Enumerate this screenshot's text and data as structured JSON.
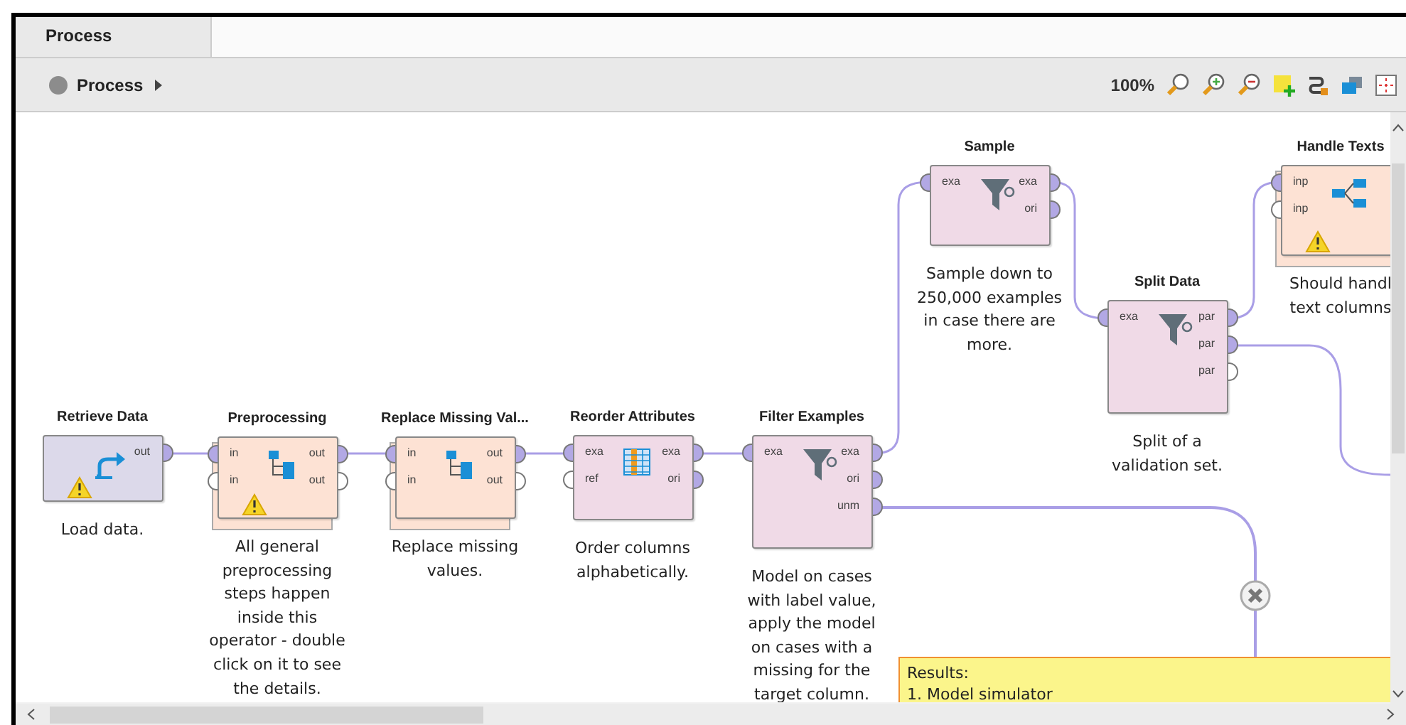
{
  "tab": {
    "label": "Process",
    "selected": true
  },
  "breadcrumb": {
    "label": "Process"
  },
  "zoom": "100%",
  "nodes": [
    {
      "title": "Retrieve Data",
      "kind": "retrieve",
      "warning": true,
      "out_ports": [
        {
          "label": "out",
          "connected": true
        }
      ],
      "description": "Load data."
    },
    {
      "title": "Preprocessing",
      "kind": "subprocess",
      "warning": true,
      "in_ports": [
        {
          "label": "in",
          "connected": true
        },
        {
          "label": "in",
          "connected": false
        }
      ],
      "out_ports": [
        {
          "label": "out",
          "connected": true
        },
        {
          "label": "out",
          "connected": false
        }
      ],
      "description": "All general\npreprocessing\nsteps happen\ninside this\noperator - double\nclick on it to see\nthe details."
    },
    {
      "title": "Replace Missing Val...",
      "kind": "subprocess",
      "warning": false,
      "in_ports": [
        {
          "label": "in",
          "connected": true
        },
        {
          "label": "in",
          "connected": false
        }
      ],
      "out_ports": [
        {
          "label": "out",
          "connected": true
        },
        {
          "label": "out",
          "connected": false
        }
      ],
      "description": "Replace missing\nvalues."
    },
    {
      "title": "Reorder Attributes",
      "kind": "table",
      "warning": false,
      "in_ports": [
        {
          "label": "exa",
          "connected": true
        },
        {
          "label": "ref",
          "connected": false
        }
      ],
      "out_ports": [
        {
          "label": "exa",
          "connected": true
        },
        {
          "label": "ori",
          "connected": true
        }
      ],
      "description": "Order columns\nalphabetically."
    },
    {
      "title": "Filter Examples",
      "kind": "filter",
      "warning": false,
      "in_ports": [
        {
          "label": "exa",
          "connected": true
        }
      ],
      "out_ports": [
        {
          "label": "exa",
          "connected": true
        },
        {
          "label": "ori",
          "connected": true
        },
        {
          "label": "unm",
          "connected": true
        }
      ],
      "description": "Model on cases\nwith label value,\napply the model\non cases with a\nmissing for the\ntarget column."
    },
    {
      "title": "Sample",
      "kind": "filter",
      "warning": false,
      "in_ports": [
        {
          "label": "exa",
          "connected": true
        }
      ],
      "out_ports": [
        {
          "label": "exa",
          "connected": true
        },
        {
          "label": "ori",
          "connected": true
        }
      ],
      "description": "Sample down to\n250,000 examples\nin case there are\nmore."
    },
    {
      "title": "Split Data",
      "kind": "filter",
      "warning": false,
      "in_ports": [
        {
          "label": "exa",
          "connected": true
        }
      ],
      "out_ports": [
        {
          "label": "par",
          "connected": true
        },
        {
          "label": "par",
          "connected": true
        },
        {
          "label": "par",
          "connected": false
        }
      ],
      "description": "Split of a\nvalidation set."
    },
    {
      "title": "Handle Texts",
      "kind": "branch",
      "warning": true,
      "in_ports": [
        {
          "label": "inp",
          "connected": true
        },
        {
          "label": "inp",
          "connected": false
        }
      ],
      "description": "Should handl\ntext columns"
    }
  ],
  "note": {
    "text": "Results:\n1. Model simulator"
  }
}
